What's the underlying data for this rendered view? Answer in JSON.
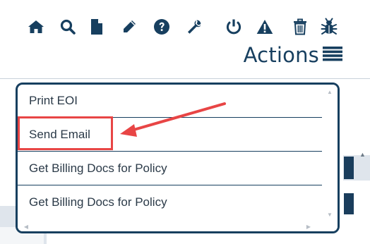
{
  "toolbar": {
    "icons": [
      {
        "name": "home-icon",
        "label": "Home"
      },
      {
        "name": "search-icon",
        "label": "Search"
      },
      {
        "name": "document-icon",
        "label": "Document"
      },
      {
        "name": "pencil-icon",
        "label": "Edit"
      },
      {
        "name": "help-icon",
        "label": "Help"
      },
      {
        "name": "wrench-icon",
        "label": "Tools"
      },
      {
        "name": "power-icon",
        "label": "Power"
      },
      {
        "name": "warning-icon",
        "label": "Warning"
      },
      {
        "name": "trash-icon",
        "label": "Delete"
      },
      {
        "name": "bug-icon",
        "label": "Bug"
      }
    ],
    "actions_label": "Actions",
    "actions_icon": "hamburger-menu-icon",
    "icon_color": "#173f5f"
  },
  "dropdown": {
    "items": [
      {
        "label": "Print EOI"
      },
      {
        "label": "Send Email"
      },
      {
        "label": "Get Billing Docs for Policy"
      },
      {
        "label": "Get Billing Docs for Policy"
      }
    ],
    "border_color": "#173f5f",
    "scroll_icons": [
      "scroll-up-icon",
      "scroll-down-icon",
      "scroll-left-icon",
      "scroll-right-icon"
    ]
  },
  "annotation": {
    "highlighted_item": "Send Email",
    "color": "#e84545"
  }
}
